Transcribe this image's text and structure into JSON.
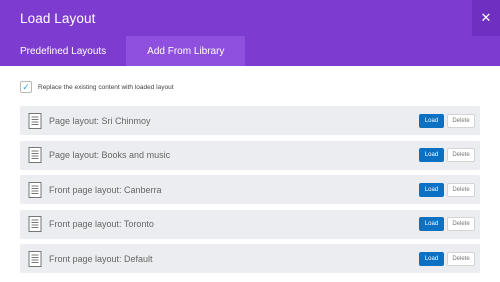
{
  "header": {
    "title": "Load Layout",
    "close_symbol": "✕"
  },
  "tabs": [
    {
      "label": "Predefined Layouts",
      "active": false
    },
    {
      "label": "Add From Library",
      "active": true
    }
  ],
  "replace_option": {
    "checked": true,
    "label": "Replace the existing content with loaded layout"
  },
  "layouts": [
    {
      "name": "Page layout: Sri Chinmoy",
      "load_label": "Load",
      "delete_label": "Delete"
    },
    {
      "name": "Page layout: Books and music",
      "load_label": "Load",
      "delete_label": "Delete"
    },
    {
      "name": "Front page layout: Canberra",
      "load_label": "Load",
      "delete_label": "Delete"
    },
    {
      "name": "Front page layout: Toronto",
      "load_label": "Load",
      "delete_label": "Delete"
    },
    {
      "name": "Front page layout: Default",
      "load_label": "Load",
      "delete_label": "Delete"
    }
  ],
  "colors": {
    "header": "#7e3bd0",
    "active_tab": "#8f50e0",
    "load_button": "#0c71c3",
    "row_background": "#ebedf0",
    "checkmark": "#2ea3f2"
  }
}
